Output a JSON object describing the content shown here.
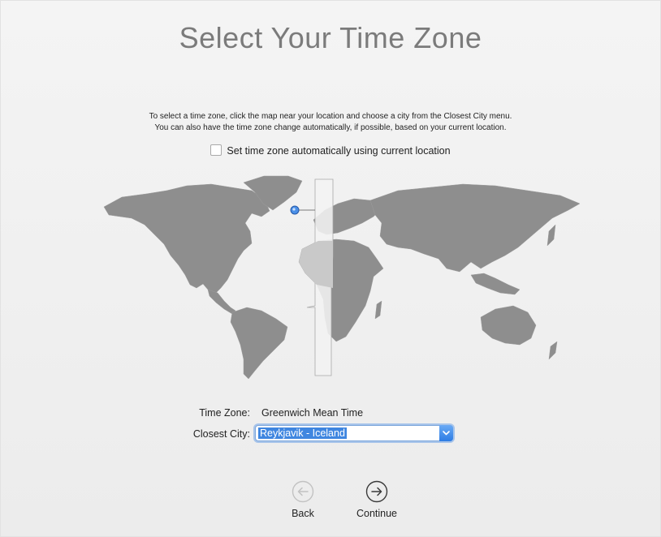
{
  "page": {
    "title": "Select Your Time Zone",
    "instruction_line1": "To select a time zone, click the map near your location and choose a city from the Closest City menu.",
    "instruction_line2": "You can also have the time zone change automatically, if possible, based on your current location.",
    "auto_checkbox_label": "Set time zone automatically using current location",
    "auto_checkbox_checked": false
  },
  "timezone": {
    "label": "Time Zone:",
    "value": "Greenwich Mean Time"
  },
  "closest_city": {
    "label": "Closest City:",
    "value": "Reykjavik - Iceland"
  },
  "nav": {
    "back_label": "Back",
    "back_enabled": false,
    "continue_label": "Continue"
  },
  "colors": {
    "accent": "#3f86e0",
    "land": "#8e8e8e",
    "title": "#7b7b7b",
    "highlight_zone": "#f3f3f3"
  },
  "icons": {
    "back": "back-arrow-circle-icon",
    "continue": "forward-arrow-circle-icon",
    "select_dropdown": "chevron-down-icon",
    "location_pin": "location-dot-icon"
  }
}
